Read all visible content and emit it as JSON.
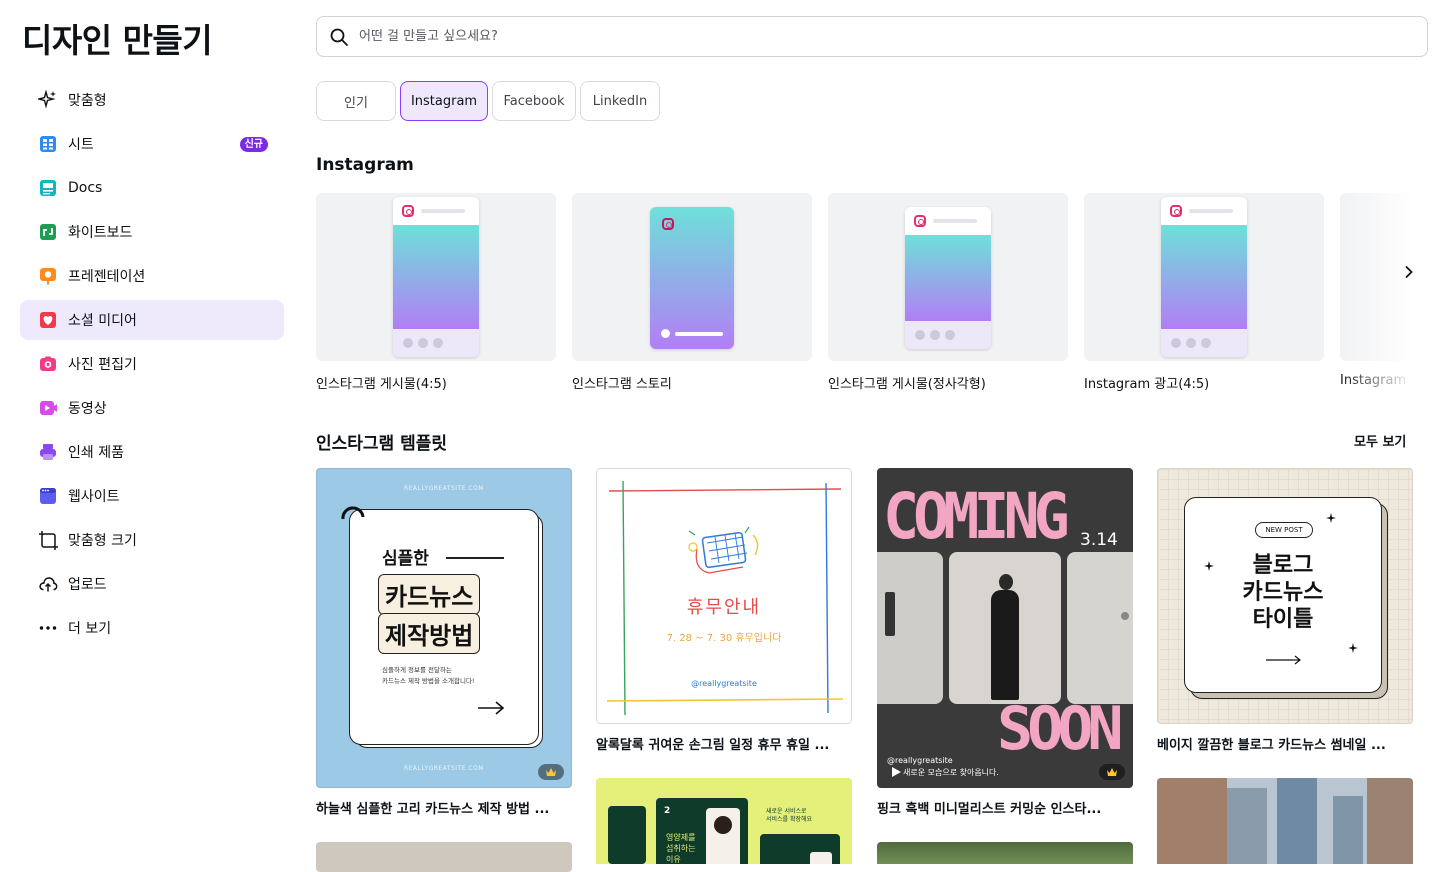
{
  "page": {
    "title": "디자인 만들기"
  },
  "sidebar": {
    "items": [
      {
        "label": "맞춤형",
        "icon": "sparkle-icon"
      },
      {
        "label": "시트",
        "icon": "sheet-icon",
        "badge": "신규"
      },
      {
        "label": "Docs",
        "icon": "docs-icon"
      },
      {
        "label": "화이트보드",
        "icon": "whiteboard-icon"
      },
      {
        "label": "프레젠테이션",
        "icon": "presentation-icon"
      },
      {
        "label": "소셜 미디어",
        "icon": "heart-icon",
        "active": true
      },
      {
        "label": "사진 편집기",
        "icon": "camera-icon"
      },
      {
        "label": "동영상",
        "icon": "video-icon"
      },
      {
        "label": "인쇄 제품",
        "icon": "printer-icon"
      },
      {
        "label": "웹사이트",
        "icon": "website-icon"
      },
      {
        "label": "맞춤형 크기",
        "icon": "custom-size-icon"
      },
      {
        "label": "업로드",
        "icon": "cloud-upload-icon"
      },
      {
        "label": "더 보기",
        "icon": "more-icon"
      }
    ]
  },
  "search": {
    "placeholder": "어떤 걸 만들고 싶으세요?"
  },
  "chips": [
    {
      "label": "인기"
    },
    {
      "label": "Instagram",
      "selected": true
    },
    {
      "label": "Facebook"
    },
    {
      "label": "LinkedIn"
    }
  ],
  "formats": {
    "title": "Instagram",
    "items": [
      {
        "label": "인스타그램 게시물(4:5)"
      },
      {
        "label": "인스타그램 스토리"
      },
      {
        "label": "인스타그램 게시물(정사각형)"
      },
      {
        "label": "Instagram 광고(4:5)"
      },
      {
        "label": "Instagram"
      }
    ]
  },
  "templates": {
    "title": "인스타그램 템플릿",
    "see_all": "모두 보기",
    "items": [
      {
        "caption": "하늘색 심플한 고리 카드뉴스 제작 방법 ...",
        "site": "REALLYGREATSITE.COM",
        "text1": "심플한",
        "text2": "카드뉴스",
        "text3": "제작방법",
        "desc1": "심플하게 정보를 전달하는",
        "desc2": "카드뉴스 제작 방법을 소개합니다!"
      },
      {
        "caption": "알록달록 귀여운 손그림 일정 휴무 휴일 ...",
        "title": "휴무안내",
        "date": "7. 28 ~ 7. 30 휴무입니다",
        "handle": "@reallygreatsite"
      },
      {
        "caption": "핑크 흑백 미니멀리스트 커밍순 인스타...",
        "coming": "COMING",
        "date": "3.14",
        "soon": "SOON",
        "handle": "@reallygreatsite",
        "sub": "새로운 모습으로 찾아옵니다."
      },
      {
        "caption": "베이지 깔끔한 블로그 카드뉴스 썸네일 ...",
        "tag": "NEW POST",
        "l1": "블로그",
        "l2": "카드뉴스",
        "l3": "타이틀"
      },
      {
        "t1": "영양제를",
        "t2": "섭취하는",
        "t3": "이유",
        "side1": "새로운 서비스로",
        "side2": "서비스를 확장해요"
      }
    ]
  },
  "colors": {
    "accent": "#8b3dff",
    "active_nav_bg": "#efeafb",
    "badge": "#7d2ae8",
    "skyblue": "#9cc9e6",
    "coming_pink": "#f2a6c4",
    "coming_bg": "#3a3a3a",
    "beige": "#efe9dd",
    "lime": "#e4f07a",
    "dark_green": "#0f3b2a"
  }
}
